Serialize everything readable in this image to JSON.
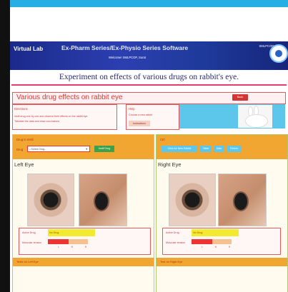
{
  "banner": {
    "brand": "Virtual Lab",
    "series": "Ex-Pharm Series/Ex-Physio Series Software",
    "welcome": "Welcome! SMLPCOP, Surat",
    "org": "SMLPCOP"
  },
  "experiment_title": "Experiment on effects of various drugs on rabbit's eye.",
  "main_heading": "Various drug effects on rabbit eye",
  "back_button": "Back",
  "directions": {
    "heading": "Directions",
    "line1": "Instil drug one by one and observe their effects on the rabbit eye.",
    "line2": "Tabulate the data and draw conclusions"
  },
  "help": {
    "heading": "Help",
    "text": "Choose a new rabbit",
    "button": "Instructions"
  },
  "left_panel": {
    "drug_to_instill": "Drug to Instil",
    "drug_label": "Drug",
    "select_value": "--Select Drug--",
    "instill_button": "Instil Drug",
    "eye_label": "Left Eye",
    "active_drug_label": "Active Drug",
    "active_drug_value": "No Drug",
    "muscular_tension_label": "Muscular tension",
    "tension_level": 0.52,
    "ticks": [
      "L",
      "N",
      "H"
    ],
    "bottom_label": "Tests on Left Eye"
  },
  "right_panel": {
    "ctrl_label": "Ctrl",
    "btn_new_rabbit": "Click for New Rabbit",
    "btn_table": "Table",
    "btn_data": "Data",
    "btn_return": "Return",
    "eye_label": "Right Eye",
    "active_drug_label": "Active Drug",
    "active_drug_value": "No Drug",
    "muscular_tension_label": "Muscular tension",
    "tension_level": 0.52,
    "ticks": [
      "L",
      "N",
      "H"
    ],
    "bottom_label": "Test on Right Eye"
  }
}
